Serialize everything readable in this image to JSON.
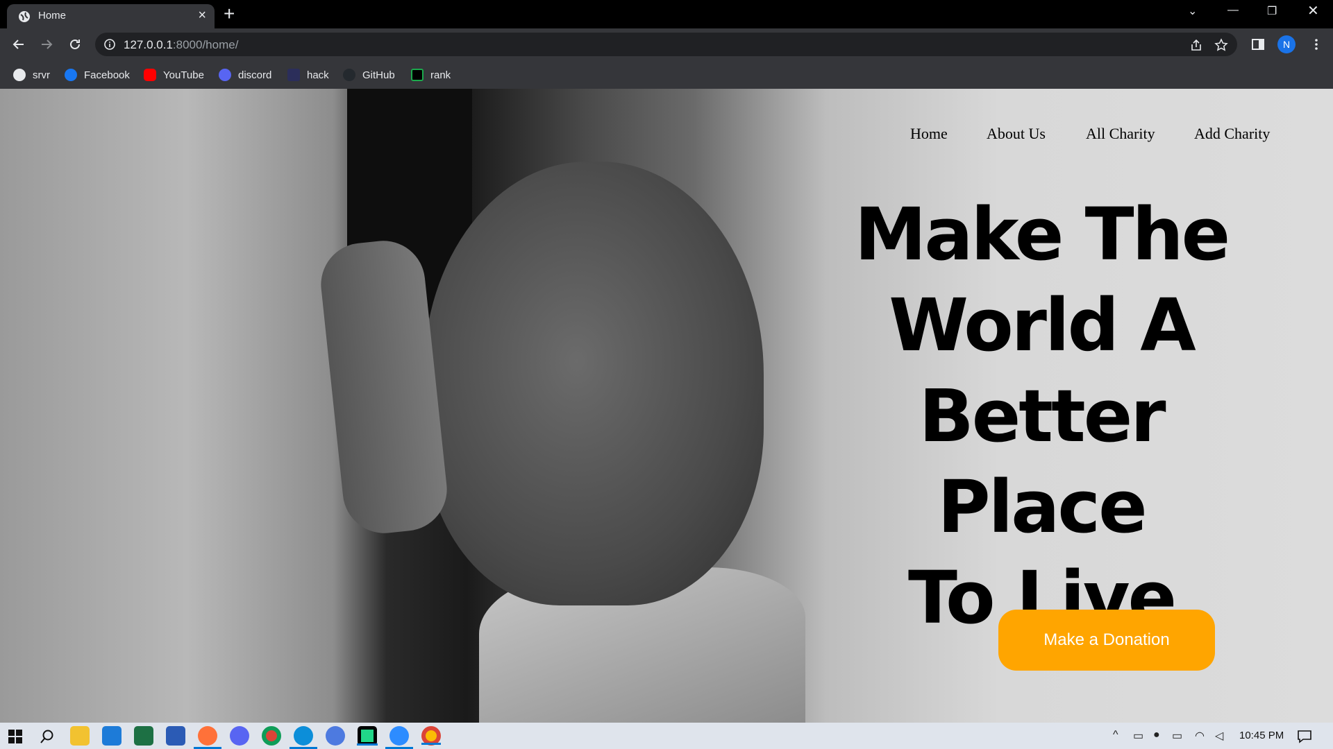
{
  "browser": {
    "tab_title": "Home",
    "url_host": "127.0.0.1",
    "url_rest": ":8000/home/",
    "avatar_letter": "N",
    "bookmarks": [
      {
        "label": "srvr",
        "color": "#e8eaed"
      },
      {
        "label": "Facebook",
        "color": "#1877f2"
      },
      {
        "label": "YouTube",
        "color": "#ff0000"
      },
      {
        "label": "discord",
        "color": "#5865f2"
      },
      {
        "label": "hack",
        "color": "#2b2e5a"
      },
      {
        "label": "GitHub",
        "color": "#24292e"
      },
      {
        "label": "rank",
        "color": "#1ba94c"
      }
    ]
  },
  "site": {
    "nav": [
      "Home",
      "About Us",
      "All Charity",
      "Add Charity"
    ],
    "hero_lines": [
      "Make The",
      "World A",
      "Better Place",
      "To Live"
    ],
    "donate_label": "Make a Donation",
    "accent_color": "#ffa500"
  },
  "taskbar": {
    "apps": [
      "start-icon",
      "search-icon",
      "file-explorer-icon",
      "mail-icon",
      "excel-icon",
      "word-icon",
      "firefox-icon",
      "discord-icon",
      "chrome-icon",
      "edge-icon",
      "messenger-icon",
      "pycharm-icon",
      "zoom-icon",
      "chrome-active-icon"
    ],
    "time": "10:45 PM"
  }
}
